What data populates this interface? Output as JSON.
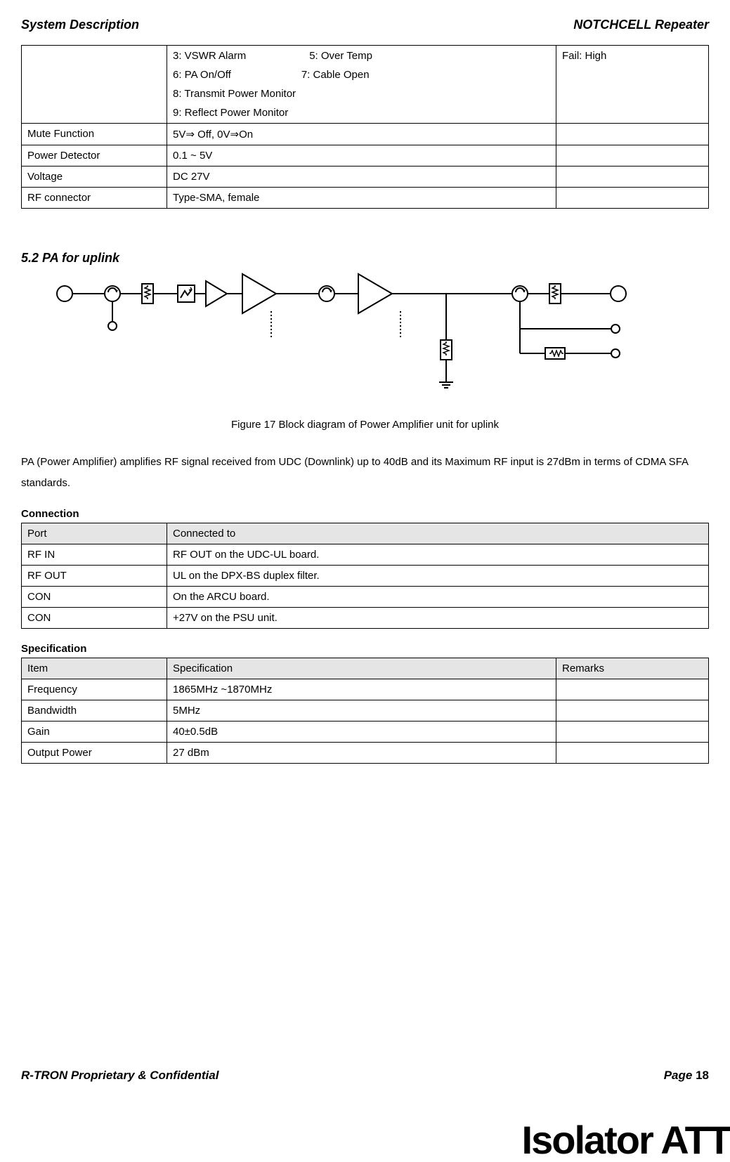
{
  "header": {
    "left": "System Description",
    "right": "NOTCHCELL Repeater"
  },
  "table1": {
    "r0": {
      "a": "",
      "b_line1_left": "3: VSWR Alarm",
      "b_line1_right": "5: Over Temp",
      "b_line2_left": "6: PA On/Off",
      "b_line2_right": "7: Cable Open",
      "b_line3": "8: Transmit Power Monitor",
      "b_line4": "9: Reflect Power Monitor",
      "c": "Fail: High"
    },
    "r1": {
      "a": "Mute Function",
      "b": "5V⇒ Off, 0V⇒On",
      "c": ""
    },
    "r2": {
      "a": "Power Detector",
      "b": "0.1 ~ 5V",
      "c": ""
    },
    "r3": {
      "a": "Voltage",
      "b": "DC 27V",
      "c": ""
    },
    "r4": {
      "a": "RF connector",
      "b": "Type-SMA, female",
      "c": ""
    }
  },
  "section52": "5.2 PA for uplink",
  "figure_caption": "Figure 17 Block diagram of Power Amplifier unit for uplink",
  "paragraph": "PA (Power Amplifier) amplifies RF signal received from UDC (Downlink) up to 40dB and its Maximum RF input is 27dBm in terms of CDMA SFA standards.",
  "connection_head": "Connection",
  "conn_table": {
    "h1": "Port",
    "h2": "Connected to",
    "r1a": "RF IN",
    "r1b": "RF OUT on the UDC-UL board.",
    "r2a": "RF OUT",
    "r2b": "UL on the DPX-BS duplex filter.",
    "r3a": "CON",
    "r3b": "On the ARCU board.",
    "r4a": "CON",
    "r4b": "+27V on the PSU unit."
  },
  "spec_head": "Specification",
  "spec_table": {
    "h1": "Item",
    "h2": "Specification",
    "h3": "Remarks",
    "r1a": "Frequency",
    "r1b": "1865MHz ~1870MHz",
    "r1c": "",
    "r2a": "Bandwidth",
    "r2b": "5MHz",
    "r2c": "",
    "r3a": "Gain",
    "r3b": "40±0.5dB",
    "r3c": "",
    "r4a": "Output Power",
    "r4b": "27 dBm",
    "r4c": ""
  },
  "footer": {
    "left": "R-TRON Proprietary & Confidential",
    "right_label": "Page ",
    "right_num": "18"
  },
  "crop_text": "Isolator          ATT"
}
